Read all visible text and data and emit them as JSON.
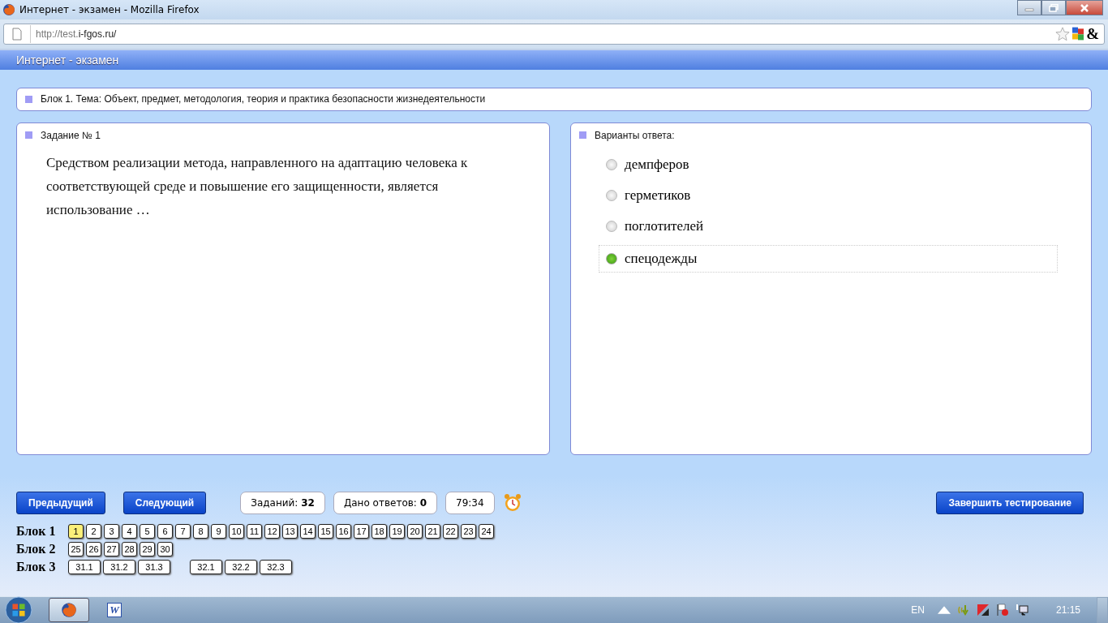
{
  "window": {
    "title": "Интернет - экзамен - Mozilla Firefox"
  },
  "address_bar": {
    "url_prefix": "http://test.",
    "url_domain": "i-fgos.ru/",
    "addon_glyph": "&"
  },
  "page_header": {
    "title": "Интернет - экзамен"
  },
  "block_panel": {
    "text": "Блок 1. Тема: Объект, предмет, методология, теория и практика безопасности жизнедеятельности"
  },
  "question_panel": {
    "heading": "Задание № 1",
    "text": "Средством реализации метода, направленного на адаптацию человека к соответствующей среде и повышение его защищенности, является использование …"
  },
  "answers_panel": {
    "heading": "Варианты ответа:",
    "options": [
      {
        "label": "демпферов",
        "selected": false
      },
      {
        "label": "герметиков",
        "selected": false
      },
      {
        "label": "поглотителей",
        "selected": false
      },
      {
        "label": "спецодежды",
        "selected": true
      }
    ]
  },
  "toolbar": {
    "prev_button": "Предыдущий",
    "next_button": "Следующий",
    "tasks_count": "Заданий: **32**",
    "answers_count": "Дано ответов: **0**",
    "timer": "79:34",
    "finish_button": "Завершить тестирование"
  },
  "blocks": [
    {
      "label": "Блок 1",
      "groups": [
        [
          {
            "label": "1",
            "selected": true
          },
          {
            "label": "2",
            "selected": false
          },
          {
            "label": "3",
            "selected": false
          },
          {
            "label": "4",
            "selected": false
          },
          {
            "label": "5",
            "selected": false
          },
          {
            "label": "6",
            "selected": false
          },
          {
            "label": "7",
            "selected": false
          },
          {
            "label": "8",
            "selected": false
          },
          {
            "label": "9",
            "selected": false
          },
          {
            "label": "10",
            "selected": false
          },
          {
            "label": "11",
            "selected": false
          },
          {
            "label": "12",
            "selected": false
          },
          {
            "label": "13",
            "selected": false
          },
          {
            "label": "14",
            "selected": false
          },
          {
            "label": "15",
            "selected": false
          },
          {
            "label": "16",
            "selected": false
          },
          {
            "label": "17",
            "selected": false
          },
          {
            "label": "18",
            "selected": false
          },
          {
            "label": "19",
            "selected": false
          },
          {
            "label": "20",
            "selected": false
          },
          {
            "label": "21",
            "selected": false
          },
          {
            "label": "22",
            "selected": false
          },
          {
            "label": "23",
            "selected": false
          },
          {
            "label": "24",
            "selected": false
          }
        ]
      ]
    },
    {
      "label": "Блок 2",
      "groups": [
        [
          {
            "label": "25",
            "selected": false
          },
          {
            "label": "26",
            "selected": false
          },
          {
            "label": "27",
            "selected": false
          },
          {
            "label": "28",
            "selected": false
          },
          {
            "label": "29",
            "selected": false
          },
          {
            "label": "30",
            "selected": false
          }
        ]
      ]
    },
    {
      "label": "Блок 3",
      "groups": [
        [
          {
            "label": "31.1",
            "selected": false
          },
          {
            "label": "31.2",
            "selected": false
          },
          {
            "label": "31.3",
            "selected": false
          }
        ],
        [
          {
            "label": "32.1",
            "selected": false
          },
          {
            "label": "32.2",
            "selected": false
          },
          {
            "label": "32.3",
            "selected": false
          }
        ]
      ]
    }
  ],
  "taskbar": {
    "word_glyph": "W",
    "language": "EN",
    "clock": "21:15"
  }
}
